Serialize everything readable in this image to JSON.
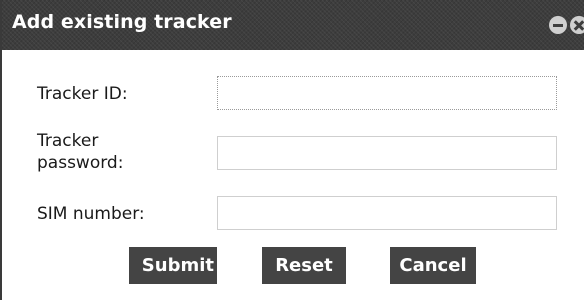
{
  "dialog": {
    "title": "Add existing tracker"
  },
  "form": {
    "tracker_id_label": "Tracker ID:",
    "tracker_password_label_line1": "Tracker",
    "tracker_password_label_line2": "password:",
    "sim_number_label": "SIM number:",
    "tracker_id_value": "",
    "tracker_password_value": "",
    "sim_number_value": ""
  },
  "buttons": {
    "submit": "Submit",
    "reset": "Reset",
    "cancel": "Cancel"
  },
  "icons": {
    "minimize": "minimize-icon",
    "close": "close-icon"
  },
  "colors": {
    "titlebar": "#3d3d3d",
    "button": "#444444"
  }
}
